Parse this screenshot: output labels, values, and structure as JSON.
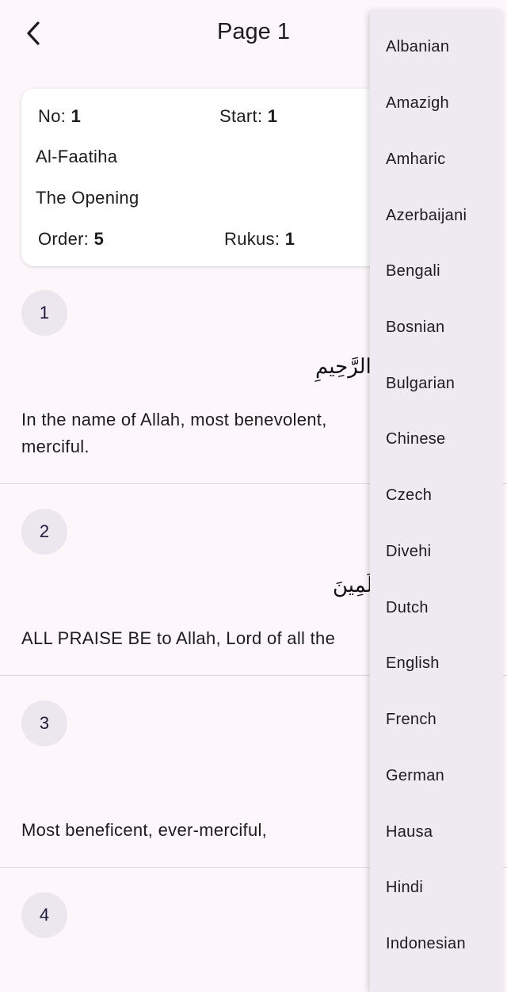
{
  "header": {
    "title": "Page 1",
    "back_icon": "chevron-left-icon"
  },
  "info_card": {
    "no_label": "No:",
    "no_value": "1",
    "start_label": "Start:",
    "start_value": "1",
    "name": "Al-Faatiha",
    "english_name": "The Opening",
    "order_label": "Order:",
    "order_value": "5",
    "rukus_label": "Rukus:",
    "rukus_value": "1"
  },
  "ayahs": [
    {
      "number": "1",
      "arabic": "الرَّحِيمِ",
      "translation": "In the name of Allah, most benevolent, merciful."
    },
    {
      "number": "2",
      "arabic": "الْعَالَمِينَ",
      "translation": "ALL PRAISE BE to Allah, Lord of all the"
    },
    {
      "number": "3",
      "arabic": "",
      "translation": "Most beneficent, ever-merciful,"
    },
    {
      "number": "4",
      "arabic": "",
      "translation": ""
    }
  ],
  "language_menu": {
    "items": [
      "Albanian",
      "Amazigh",
      "Amharic",
      "Azerbaijani",
      "Bengali",
      "Bosnian",
      "Bulgarian",
      "Chinese",
      "Czech",
      "Divehi",
      "Dutch",
      "English",
      "French",
      "German",
      "Hausa",
      "Hindi",
      "Indonesian"
    ]
  }
}
